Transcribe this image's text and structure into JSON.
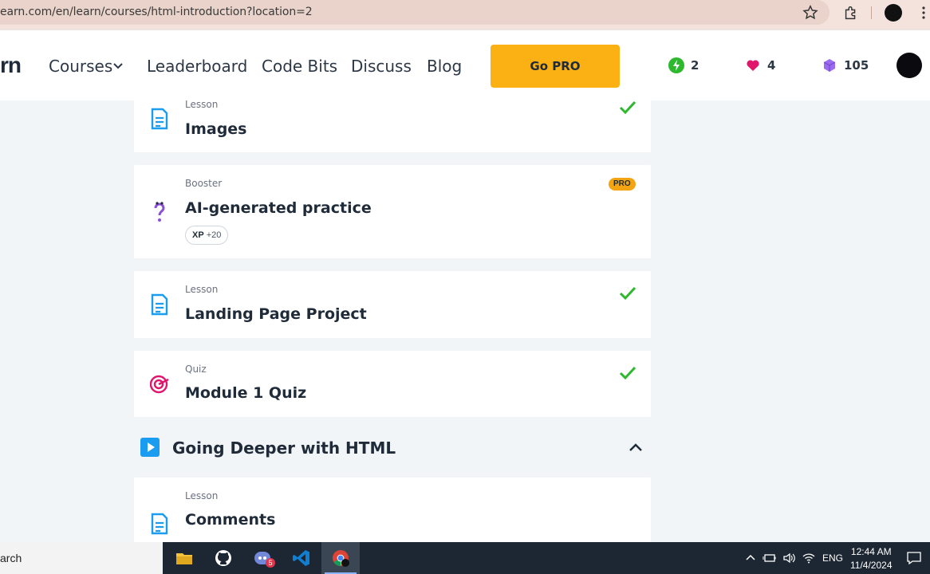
{
  "browser": {
    "url": "earn.com/en/learn/courses/html-introduction?location=2"
  },
  "site_nav": {
    "logo_fragment": "rn",
    "items": [
      {
        "label": "Courses"
      },
      {
        "label": "Leaderboard"
      },
      {
        "label": "Code Bits"
      },
      {
        "label": "Discuss"
      },
      {
        "label": "Blog"
      }
    ],
    "go_pro_label": "Go PRO",
    "streak": "2",
    "hearts": "4",
    "gems": "105"
  },
  "cards": [
    {
      "type": "Lesson",
      "title": "Images",
      "completed": true
    },
    {
      "type": "Booster",
      "title": "AI-generated practice",
      "badge": "PRO",
      "xp_label": "XP",
      "xp_value": "+20"
    },
    {
      "type": "Lesson",
      "title": "Landing Page Project",
      "completed": true
    },
    {
      "type": "Quiz",
      "title": "Module 1 Quiz",
      "completed": true
    },
    {
      "type": "Lesson",
      "title": "Comments"
    }
  ],
  "section": {
    "title": "Going Deeper with HTML"
  },
  "taskbar": {
    "search_text": "arch",
    "discord_badge": "5",
    "language": "ENG",
    "time": "12:44 AM",
    "date": "11/4/2024"
  },
  "colors": {
    "accent_orange": "#fbb114",
    "check_green": "#2db82d",
    "lesson_blue": "#1a9cf0",
    "quiz_pink": "#e0156b",
    "booster_purple": "#8a4fd8"
  }
}
